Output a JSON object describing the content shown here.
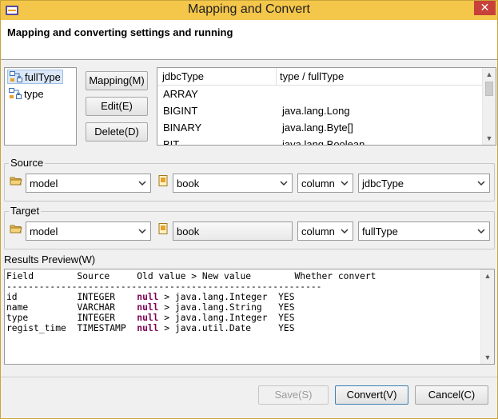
{
  "window": {
    "title": "Mapping and Convert",
    "close_glyph": "✕"
  },
  "header": {
    "description": "Mapping and converting settings and running"
  },
  "tree": {
    "items": [
      {
        "label": "fullType",
        "icon": "mapping-icon",
        "selected": true
      },
      {
        "label": "type",
        "icon": "mapping-icon",
        "selected": false
      }
    ]
  },
  "buttons": {
    "mapping": "Mapping(M)",
    "edit": "Edit(E)",
    "delete": "Delete(D)",
    "save": "Save(S)",
    "convert": "Convert(V)",
    "cancel": "Cancel(C)"
  },
  "type_table": {
    "columns": [
      "jdbcType",
      "type / fullType"
    ],
    "rows": [
      [
        "ARRAY",
        ""
      ],
      [
        "BIGINT",
        "java.lang.Long"
      ],
      [
        "BINARY",
        "java.lang.Byte[]"
      ],
      [
        "BIT",
        "java.lang.Boolean"
      ]
    ]
  },
  "source": {
    "label": "Source",
    "project": "model",
    "table": "book",
    "mode": "column",
    "field": "jdbcType"
  },
  "target": {
    "label": "Target",
    "project": "model",
    "table": "book",
    "mode": "column",
    "field": "fullType"
  },
  "preview": {
    "label": "Results Preview(W)",
    "header": "Field        Source     Old value > New value        Whether convert",
    "divider": "----------------------------------------------------------",
    "rows": [
      {
        "field": "id",
        "source": "INTEGER",
        "old": "null",
        "new": "java.lang.Integer",
        "convert": "YES"
      },
      {
        "field": "name",
        "source": "VARCHAR",
        "old": "null",
        "new": "java.lang.String",
        "convert": "YES"
      },
      {
        "field": "type",
        "source": "INTEGER",
        "old": "null",
        "new": "java.lang.Integer",
        "convert": "YES"
      },
      {
        "field": "regist_time",
        "source": "TIMESTAMP",
        "old": "null",
        "new": "java.util.Date",
        "convert": "YES"
      }
    ]
  },
  "colors": {
    "titlebar": "#f4c64a",
    "close": "#c7413a",
    "keyword": "#7f0055",
    "selection": "#dce8f7"
  }
}
